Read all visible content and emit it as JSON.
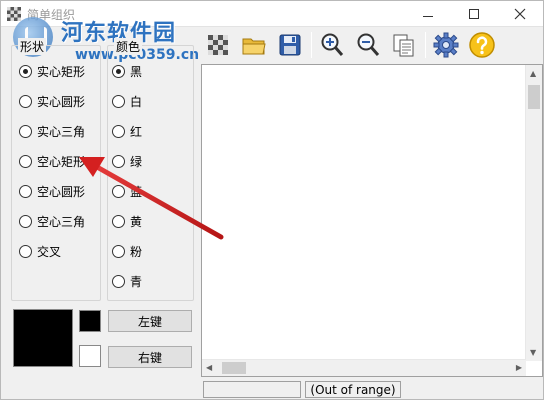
{
  "window": {
    "title": "简单组织"
  },
  "watermark": {
    "name": "河东软件园",
    "url": "www.pc0359.cn"
  },
  "toolbar": {
    "icons": [
      "checker-icon",
      "open-folder-icon",
      "save-disk-icon",
      "zoom-in-icon",
      "zoom-out-icon",
      "copy-pages-icon",
      "gear-icon",
      "help-icon"
    ]
  },
  "shape_group": {
    "label": "形状",
    "options": [
      "实心矩形",
      "实心圆形",
      "实心三角",
      "空心矩形",
      "空心圆形",
      "空心三角",
      "交叉"
    ],
    "selected": 0
  },
  "color_group": {
    "label": "颜色",
    "options": [
      "黑",
      "白",
      "红",
      "绿",
      "蓝",
      "黄",
      "粉",
      "青"
    ],
    "selected": 0
  },
  "keys": {
    "left": "左键",
    "right": "右键"
  },
  "colors": {
    "main_swatch": "#000000",
    "left_swatch": "#000000",
    "right_swatch": "#ffffff",
    "arrow": "#d42020"
  },
  "status": {
    "left": "",
    "right": "(Out of range)"
  }
}
